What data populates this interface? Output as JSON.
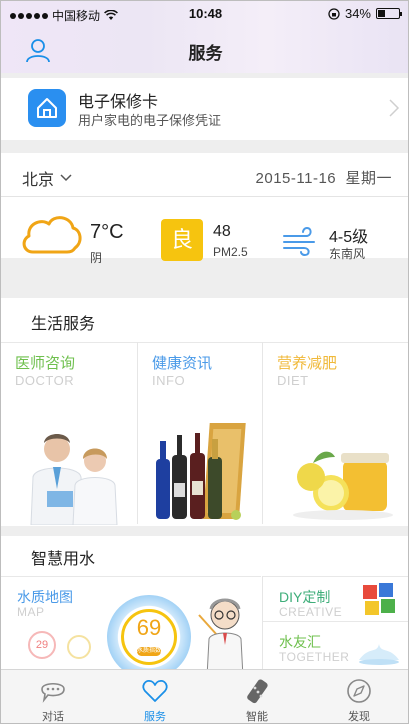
{
  "status_bar": {
    "carrier": "中国移动",
    "time": "10:48",
    "battery": "34%",
    "battery_level": 0.34
  },
  "header": {
    "title": "服务"
  },
  "warranty_card": {
    "title": "电子保修卡",
    "subtitle": "用户家电的电子保修凭证"
  },
  "weather": {
    "city": "北京",
    "date": "2015-11-16",
    "weekday": "星期一",
    "temperature": "7°C",
    "condition": "阴",
    "aqi_grade": "良",
    "aqi_value": "48",
    "aqi_label": "PM2.5",
    "wind_level": "4-5级",
    "wind_direction": "东南风"
  },
  "life_services": {
    "title": "生活服务",
    "tiles": [
      {
        "cn": "医师咨询",
        "en": "DOCTOR",
        "color": "#6fc04e"
      },
      {
        "cn": "健康资讯",
        "en": "INFO",
        "color": "#4a9ae8"
      },
      {
        "cn": "营养减肥",
        "en": "DIET",
        "color": "#f0b93a"
      }
    ]
  },
  "smart_water": {
    "title": "智慧用水",
    "quality_map": {
      "cn": "水质地图",
      "en": "MAP",
      "score": "69",
      "score_label": "水质指数"
    },
    "diy": {
      "cn": "DIY定制",
      "en": "CREATIVE"
    },
    "friends": {
      "cn": "水友汇",
      "en": "TOGETHER"
    },
    "small_badge": "29"
  },
  "tab_bar": {
    "items": [
      {
        "label": "对话",
        "icon": "chat-icon"
      },
      {
        "label": "服务",
        "icon": "heart-icon",
        "active": true
      },
      {
        "label": "智能",
        "icon": "remote-icon"
      },
      {
        "label": "发现",
        "icon": "compass-icon"
      }
    ]
  },
  "colors": {
    "accent": "#1a8fe8",
    "aqi_badge": "#f6c40f",
    "weather_icon": "#f0a516"
  }
}
